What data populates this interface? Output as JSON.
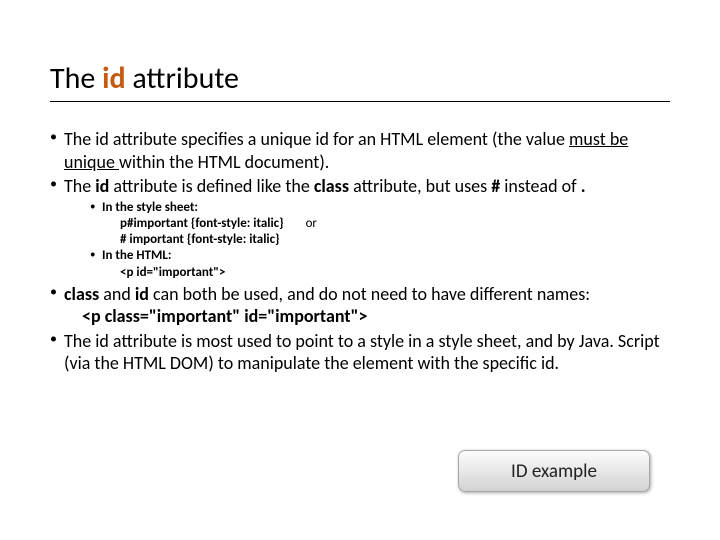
{
  "title": {
    "prefix": "The ",
    "id": "id",
    "suffix": " attribute"
  },
  "bullets": {
    "b1a": "The id attribute specifies a unique id for an HTML element (the value ",
    "b1b": "must be unique ",
    "b1c": "within the HTML document).",
    "b2a": "The ",
    "b2b": "id ",
    "b2c": "attribute is defined like the ",
    "b2d": "class ",
    "b2e": "attribute, but uses ",
    "b2f": "# ",
    "b2g": "instead of ",
    "b2h": ".",
    "sub1": "In the style sheet:",
    "code1": "p#important {font-style: italic}",
    "or": "or",
    "code2": "# important {font-style: italic}",
    "sub2": "In the HTML:",
    "code3": "<p id=\"important\">",
    "b3a": "class ",
    "b3b": "and ",
    "b3c": "id ",
    "b3d": "can both be used, and do not need to have different names:",
    "code4": "<p class=\"important\" id=\"important\">",
    "b4": "The id attribute is most used to point to a style in a style sheet, and by Java. Script (via the HTML DOM) to manipulate the element with the specific id."
  },
  "button": {
    "label": "ID example"
  }
}
